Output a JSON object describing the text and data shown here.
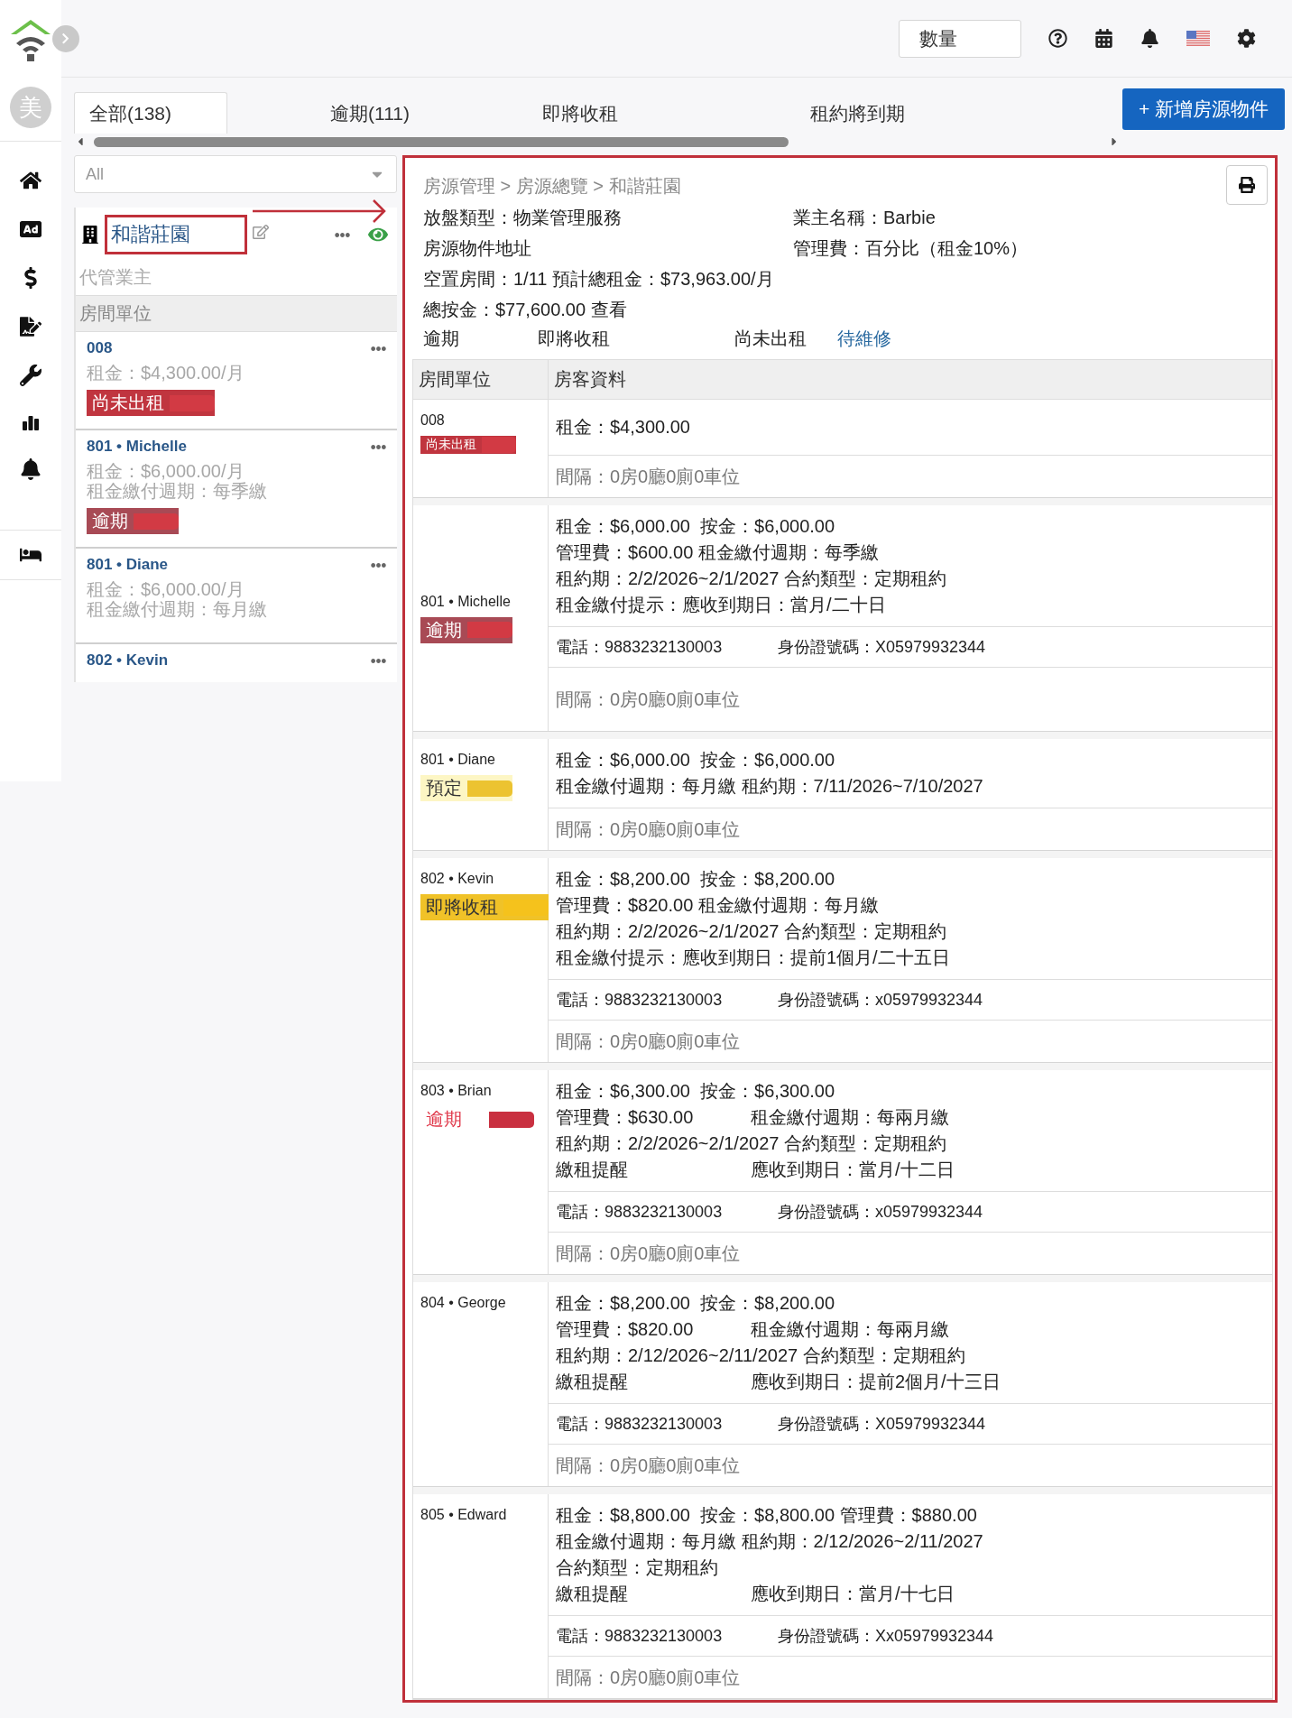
{
  "topbar": {
    "quantity_button": "數量"
  },
  "avatar": "美",
  "tabs": [
    {
      "label": "全部(138)",
      "selected": true
    },
    {
      "label": "逾期(111)",
      "selected": false
    },
    {
      "label": "即將收租",
      "selected": false
    },
    {
      "label": "租約將到期",
      "selected": false
    }
  ],
  "add_button": "+ 新增房源物件",
  "filter": {
    "value": "All"
  },
  "property": {
    "name": "和諧莊園",
    "owner_label": "代管業主",
    "units_header": "房間單位"
  },
  "units": [
    {
      "title": "008",
      "lines": [
        "租金：$4,300.00/月"
      ],
      "status": {
        "kind": "vacant",
        "label": "尚未出租"
      }
    },
    {
      "title": "801 • Michelle",
      "lines": [
        "租金：$6,000.00/月",
        "租金繳付週期：每季繳"
      ],
      "status": {
        "kind": "overdue",
        "label": "逾期"
      }
    },
    {
      "title": "801 • Diane",
      "lines": [
        "租金：$6,000.00/月",
        "租金繳付週期：每月繳"
      ]
    },
    {
      "title": "802 • Kevin"
    }
  ],
  "detail": {
    "breadcrumb": "房源管理 > 房源總覽 > 和諧莊園",
    "info": [
      [
        "放盤類型：物業管理服務",
        "業主名稱：Barbie"
      ],
      [
        "房源物件地址",
        "管理費：百分比（租金10%）"
      ],
      [
        "空置房間：1/11 預計總租金：$73,963.00/月"
      ],
      [
        "總按金：$77,600.00 查看"
      ]
    ],
    "legend": [
      {
        "label": "逾期",
        "kind": "plain"
      },
      {
        "label": "即將收租",
        "kind": "plain"
      },
      {
        "label": "尚未出租",
        "kind": "plain"
      },
      {
        "label": "待維修",
        "kind": "link"
      }
    ],
    "columns": [
      "房間單位",
      "房客資料"
    ],
    "rows": [
      {
        "unit": "008",
        "status": {
          "kind": "vacant",
          "label": "尚未出租"
        },
        "lines": [
          [
            "租金：$4,300.00"
          ]
        ],
        "interval": "間隔：0房0廳0廁0車位"
      },
      {
        "unit": "801 • Michelle",
        "status": {
          "kind": "overdue",
          "label": "逾期"
        },
        "lines": [
          [
            "租金：$6,000.00  按金：$6,000.00"
          ],
          [
            "管理費：$600.00 租金繳付週期：每季繳"
          ],
          [
            "租約期：2/2/2026~2/1/2027 合約類型：定期租約"
          ],
          [
            "租金繳付提示：應收到期日：當月/二十日"
          ]
        ],
        "contact": {
          "phone": "電話：9883232130003",
          "id": "身份證號碼：X05979932344"
        },
        "interval": "間隔：0房0廳0廁0車位"
      },
      {
        "unit": "801 • Diane",
        "status": {
          "kind": "reserved",
          "label": "預定"
        },
        "lines": [
          [
            "租金：$6,000.00  按金：$6,000.00"
          ],
          [
            "租金繳付週期：每月繳 租約期：7/11/2026~7/10/2027"
          ]
        ],
        "interval": "間隔：0房0廳0廁0車位"
      },
      {
        "unit": "802 • Kevin",
        "status": {
          "kind": "due",
          "label": "即將收租"
        },
        "lines": [
          [
            "租金：$8,200.00  按金：$8,200.00"
          ],
          [
            "管理費：$820.00 租金繳付週期：每月繳"
          ],
          [
            "租約期：2/2/2026~2/1/2027 合約類型：定期租約"
          ],
          [
            "租金繳付提示：應收到期日：提前1個月/二十五日"
          ]
        ],
        "contact": {
          "phone": "電話：9883232130003",
          "id": "身份證號碼：x05979932344"
        },
        "interval": "間隔：0房0廳0廁0車位"
      },
      {
        "unit": "803 • Brian",
        "status": {
          "kind": "alert",
          "label": "逾期"
        },
        "lines": [
          [
            "租金：$6,300.00  按金：$6,300.00"
          ],
          [
            "管理費：$630.00",
            "租金繳付週期：每兩月繳"
          ],
          [
            "租約期：2/2/2026~2/1/2027 合約類型：定期租約"
          ],
          [
            "繳租提醒",
            "應收到期日：當月/十二日"
          ]
        ],
        "contact": {
          "phone": "電話：9883232130003",
          "id": "身份證號碼：x05979932344"
        },
        "interval": "間隔：0房0廳0廁0車位"
      },
      {
        "unit": "804 • George",
        "lines": [
          [
            "租金：$8,200.00  按金：$8,200.00"
          ],
          [
            "管理費：$820.00",
            "租金繳付週期：每兩月繳"
          ],
          [
            "租約期：2/12/2026~2/11/2027 合約類型：定期租約"
          ],
          [
            "繳租提醒",
            "應收到期日：提前2個月/十三日"
          ]
        ],
        "contact": {
          "phone": "電話：9883232130003",
          "id": "身份證號碼：X05979932344"
        },
        "interval": "間隔：0房0廳0廁0車位"
      },
      {
        "unit": "805 • Edward",
        "lines": [
          [
            "租金：$8,800.00  按金：$8,800.00 管理費：$880.00"
          ],
          [
            "租金繳付週期：每月繳 租約期：2/12/2026~2/11/2027"
          ],
          [
            "合約類型：定期租約"
          ],
          [
            "繳租提醒",
            "應收到期日：當月/十七日"
          ]
        ],
        "contact": {
          "phone": "電話：9883232130003",
          "id": "身份證號碼：Xx05979932344"
        },
        "interval": "間隔：0房0廳0廁0車位"
      }
    ]
  }
}
